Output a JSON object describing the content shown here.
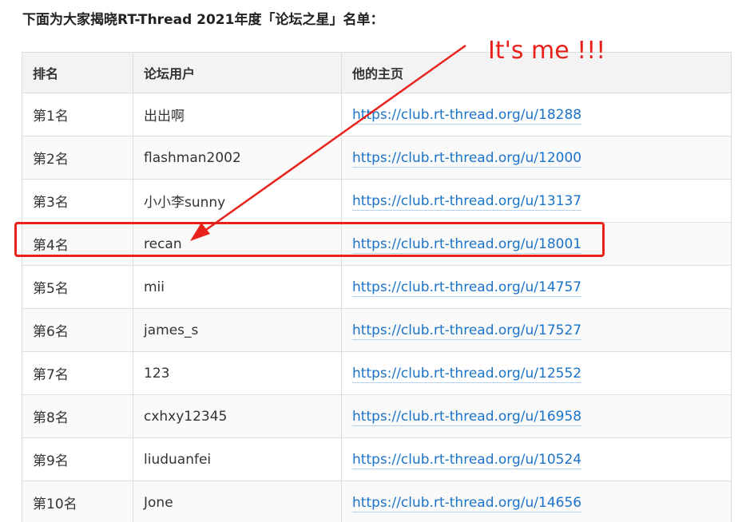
{
  "heading": "下面为大家揭晓RT-Thread 2021年度「论坛之星」名单：",
  "annotation": "It's me !!!",
  "colors": {
    "annotation": "#e8211b",
    "link": "#1a73c9",
    "header_bg": "#f3f3f3",
    "border": "#dddddd"
  },
  "table": {
    "headers": [
      "排名",
      "论坛用户",
      "他的主页"
    ],
    "rows": [
      {
        "rank": "第1名",
        "user": "出出啊",
        "home": "https://club.rt-thread.org/u/18288"
      },
      {
        "rank": "第2名",
        "user": "flashman2002",
        "home": "https://club.rt-thread.org/u/12000"
      },
      {
        "rank": "第3名",
        "user": "小小李sunny",
        "home": "https://club.rt-thread.org/u/13137"
      },
      {
        "rank": "第4名",
        "user": "recan",
        "home": "https://club.rt-thread.org/u/18001"
      },
      {
        "rank": "第5名",
        "user": "mii",
        "home": "https://club.rt-thread.org/u/14757"
      },
      {
        "rank": "第6名",
        "user": "james_s",
        "home": "https://club.rt-thread.org/u/17527"
      },
      {
        "rank": "第7名",
        "user": "123",
        "home": "https://club.rt-thread.org/u/12552"
      },
      {
        "rank": "第8名",
        "user": "cxhxy12345",
        "home": "https://club.rt-thread.org/u/16958"
      },
      {
        "rank": "第9名",
        "user": "liuduanfei",
        "home": "https://club.rt-thread.org/u/10524"
      },
      {
        "rank": "第10名",
        "user": "Jone",
        "home": "https://club.rt-thread.org/u/14656"
      }
    ],
    "highlighted_rank": "第4名"
  }
}
